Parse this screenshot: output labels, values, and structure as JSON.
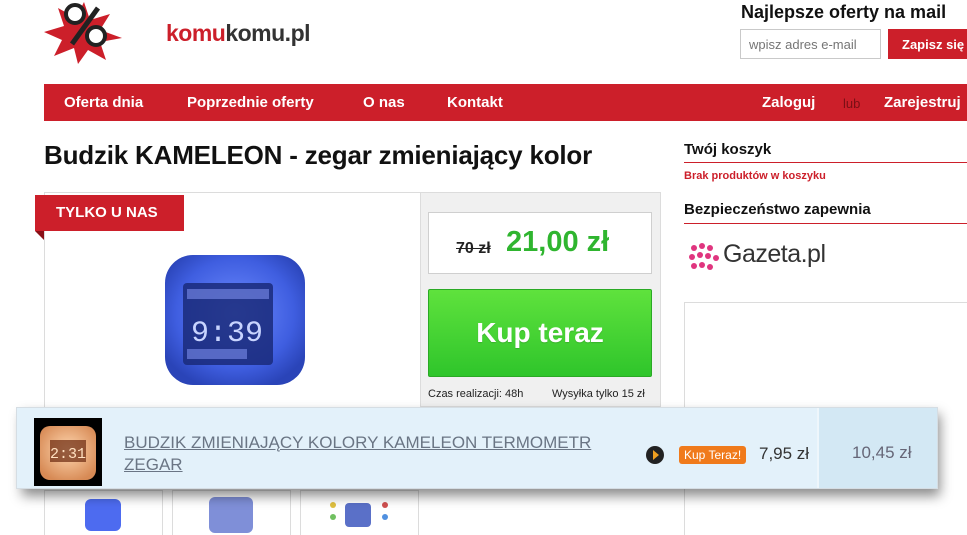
{
  "brand": {
    "name_part1": "komu",
    "name_part2": "komu.pl"
  },
  "newsletter": {
    "title": "Najlepsze oferty na mail",
    "placeholder": "wpisz adres e-mail",
    "button": "Zapisz się"
  },
  "nav": {
    "items": [
      "Oferta dnia",
      "Poprzednie oferty",
      "O nas",
      "Kontakt"
    ],
    "login": "Zaloguj",
    "or": "lub",
    "register": "Zarejestruj"
  },
  "product": {
    "title": "Budzik KAMELEON - zegar zmieniający kolor",
    "badge": "TYLKO U NAS",
    "old_price": "70 zł",
    "price": "21,00 zł",
    "buy": "Kup teraz",
    "realization": "Czas realizacji: 48h",
    "shipping": "Wysyłka tylko 15 zł",
    "clock_time": "9:39"
  },
  "sidebar": {
    "cart_title": "Twój koszyk",
    "cart_empty": "Brak produktów w koszyku",
    "security_title": "Bezpieczeństwo zapewnia",
    "partner": "Gazeta.pl"
  },
  "popup": {
    "name": "BUDZIK ZMIENIAJĄCY KOLORY KAMELEON TERMOMETR ZEGAR",
    "buy_label": "Kup Teraz!",
    "price": "7,95 zł",
    "old_price": "10,45 zł",
    "thumb_time": "2:31"
  },
  "colors": {
    "brand_red": "#cc1f2a",
    "buy_green": "#3ccf30",
    "price_green": "#2fb52f",
    "popup_orange": "#f07a1b"
  }
}
